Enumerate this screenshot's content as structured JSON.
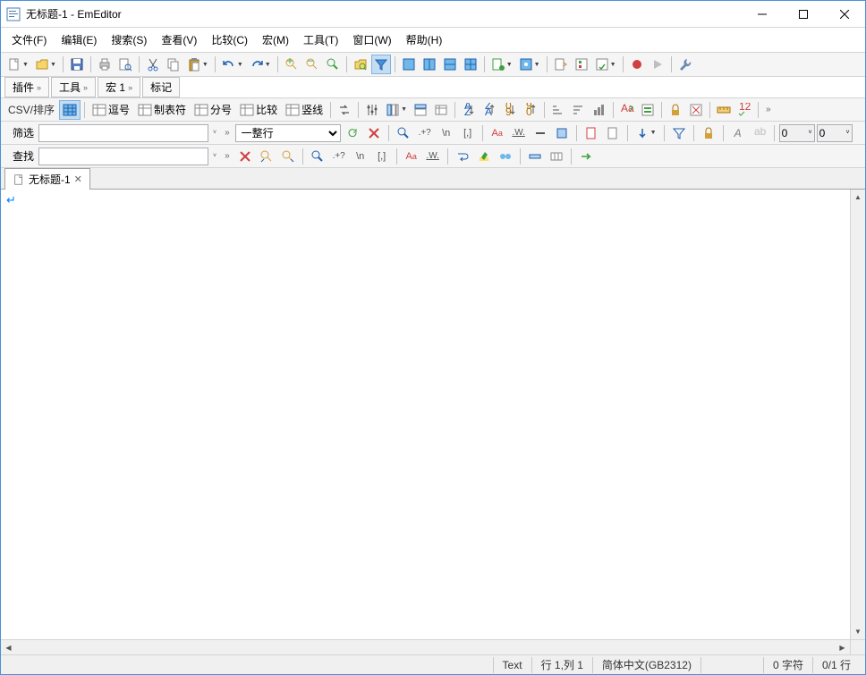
{
  "title": "无标题-1 - EmEditor",
  "menu": {
    "file": "文件(F)",
    "edit": "编辑(E)",
    "search": "搜索(S)",
    "view": "查看(V)",
    "compare": "比较(C)",
    "macro": "宏(M)",
    "tool": "工具(T)",
    "window": "窗口(W)",
    "help": "帮助(H)"
  },
  "tooltabs": {
    "plugins": "插件",
    "tools": "工具",
    "macro": "宏  1",
    "marks": "标记"
  },
  "csv": {
    "label": "CSV/排序",
    "comma": "逗号",
    "tab": "制表符",
    "semicolon": "分号",
    "compare": "比较",
    "vline": "竖线"
  },
  "filter": {
    "label": "筛选",
    "whole_line": "一整行",
    "num0a": "0",
    "num0b": "0"
  },
  "find": {
    "label": "查找"
  },
  "doctab": {
    "name": "无标题-1"
  },
  "status": {
    "mode": "Text",
    "pos": "行 1,列 1",
    "encoding": "简体中文(GB2312)",
    "chars": "0 字符",
    "lines": "0/1 行"
  }
}
